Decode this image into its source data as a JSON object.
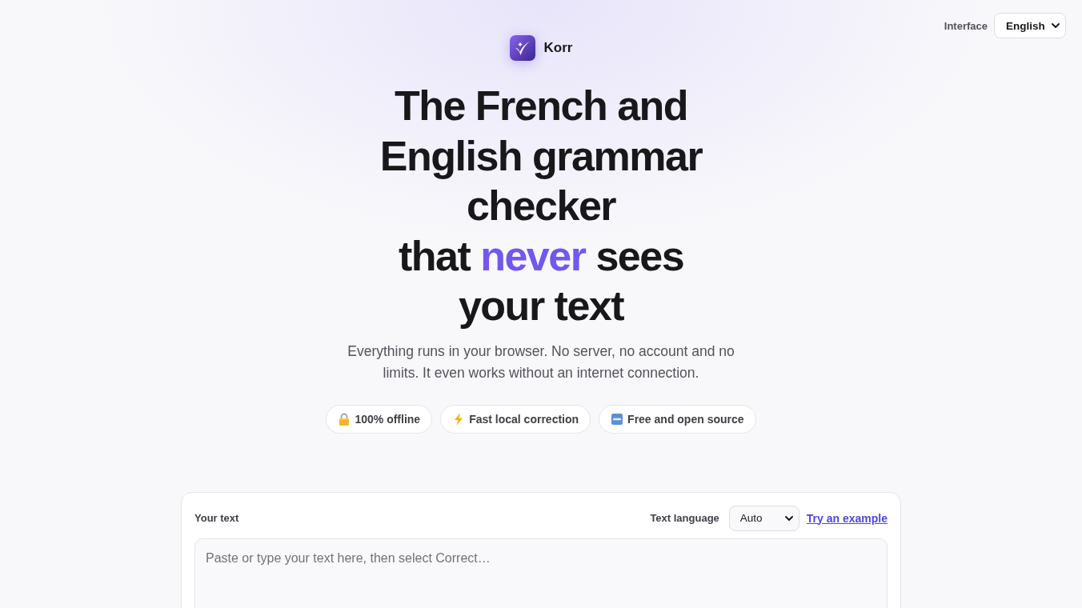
{
  "interface_language": {
    "label": "Interface",
    "value": "English"
  },
  "brand": {
    "name": "Korr"
  },
  "headline": {
    "lines": [
      [
        {
          "text": "The French and English grammar checker",
          "accent": false
        }
      ],
      [
        {
          "text": "that ",
          "accent": false
        },
        {
          "text": "never",
          "accent": true
        },
        {
          "text": " sees your text",
          "accent": false
        }
      ]
    ]
  },
  "subtitle": "Everything runs in your browser. No server, no account and no limits. It even works without an internet connection.",
  "badges": [
    {
      "kind": "lock",
      "label": "100% offline"
    },
    {
      "kind": "lightning",
      "label": "Fast local correction"
    },
    {
      "kind": "free",
      "label": "Free and open source"
    }
  ],
  "editor": {
    "title": "Your text",
    "language": {
      "label": "Text language",
      "value": "Auto"
    },
    "example_link": "Try an example",
    "placeholder": "Paste or type your text here, then select Correct…"
  }
}
